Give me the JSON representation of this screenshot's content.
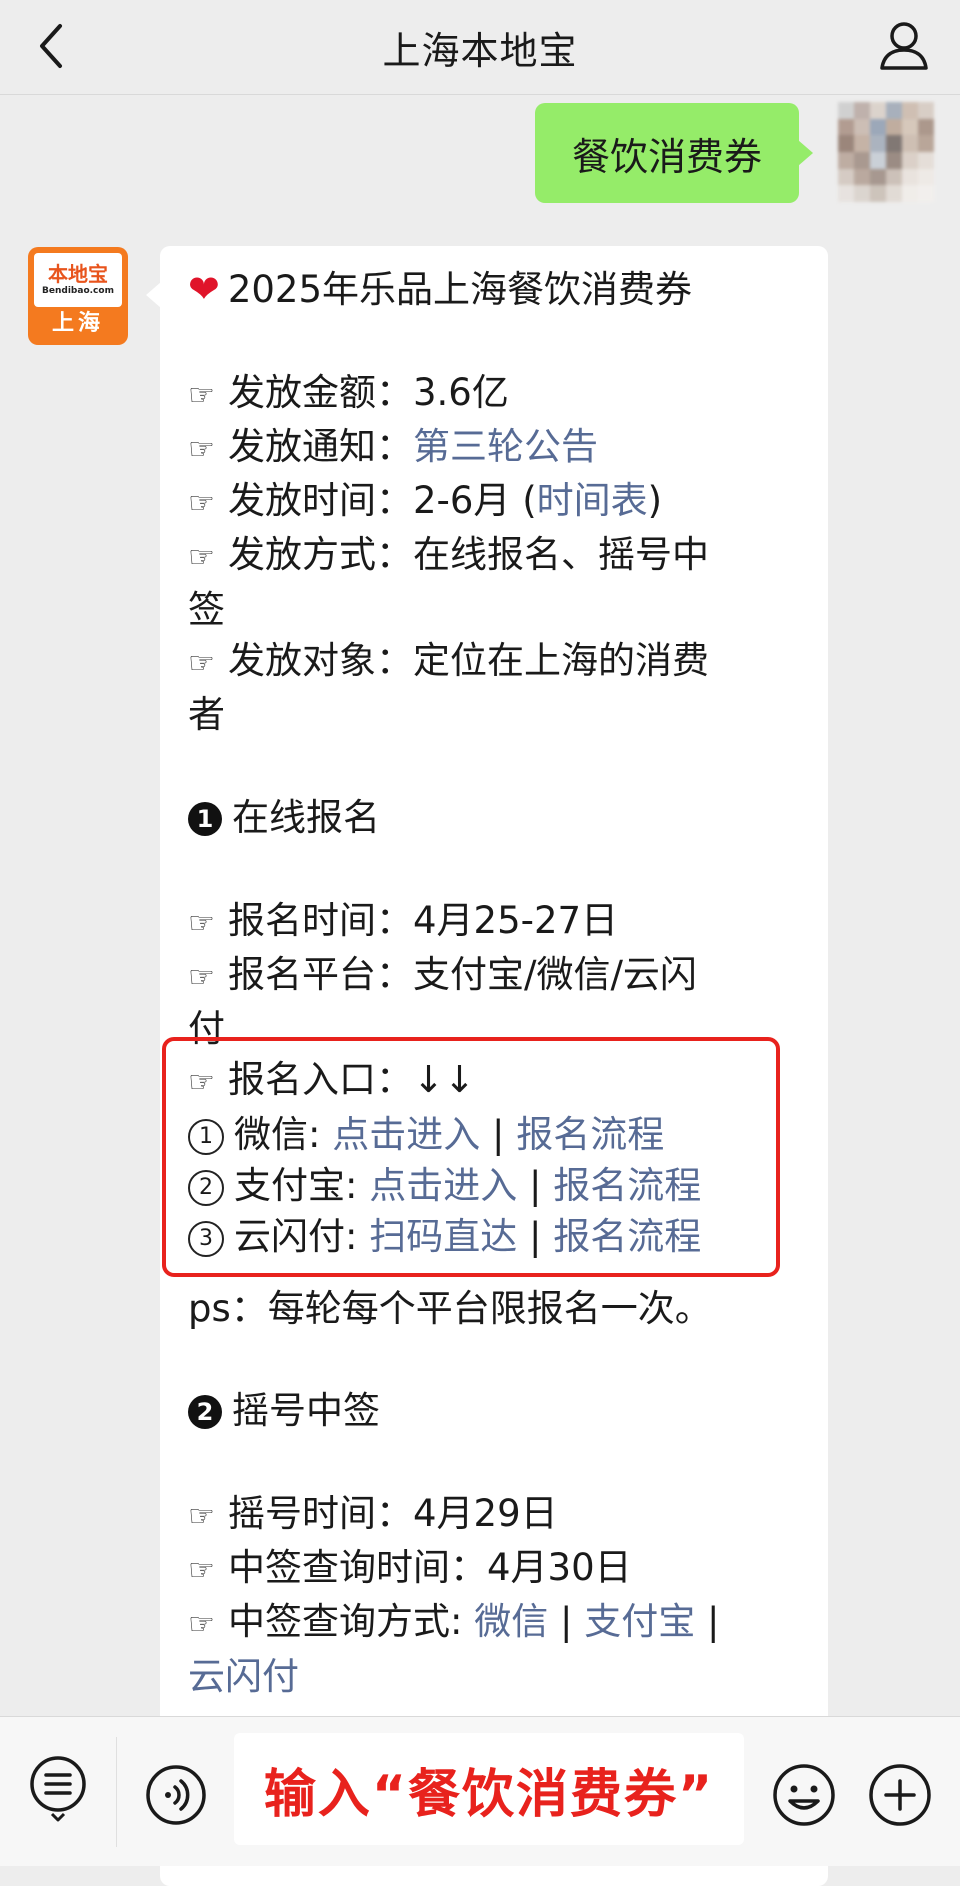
{
  "header": {
    "title": "上海本地宝"
  },
  "user_message": {
    "text": "餐饮消费券"
  },
  "bot": {
    "avatar_brand_cn": "本地宝",
    "avatar_brand_en": "Bendibao.com",
    "avatar_city": "上海"
  },
  "message": {
    "title": "2025年乐品上海餐饮消费券",
    "info": [
      {
        "label": "发放金额：",
        "value": "3.6亿"
      },
      {
        "label": "发放通知：",
        "link": "第三轮公告"
      },
      {
        "label": "发放时间：",
        "value": "2-6月 (",
        "link": "时间表",
        "suffix": ")"
      },
      {
        "label": "发放方式：",
        "value": "在线报名、摇号中",
        "wrap": "签"
      },
      {
        "label": "发放对象：",
        "value": "定位在上海的消费",
        "wrap": "者"
      }
    ],
    "section1": {
      "num": "1",
      "title": "在线报名",
      "time_label": "报名时间：",
      "time_value": "4月25-27日",
      "platform_label": "报名平台：",
      "platform_value": "支付宝/微信/云闪",
      "platform_wrap": "付",
      "entry_label": "报名入口：",
      "entry_arrows": "↓↓",
      "entries": [
        {
          "num": "1",
          "name": "微信: ",
          "link1": "点击进入",
          "sep": " | ",
          "link2": "报名流程"
        },
        {
          "num": "2",
          "name": "支付宝: ",
          "link1": "点击进入",
          "sep": " | ",
          "link2": "报名流程"
        },
        {
          "num": "3",
          "name": "云闪付: ",
          "link1": "扫码直达",
          "sep": " | ",
          "link2": "报名流程"
        }
      ],
      "ps": "ps：每轮每个平台限报名一次。"
    },
    "section2": {
      "num": "2",
      "title": "摇号中签",
      "lottery_label": "摇号时间：",
      "lottery_value": "4月29日",
      "query_time_label": "中签查询时间：",
      "query_time_value": "4月30日",
      "query_method_label": "中签查询方式: ",
      "query_link1": "微信",
      "query_sep1": " | ",
      "query_link2": "支付宝",
      "query_sep2": " |",
      "query_link3": "云闪付"
    }
  },
  "input": {
    "overlay_text": "输入“餐饮消费券”"
  },
  "colors": {
    "link": "#576b95",
    "user_bubble": "#95ec69",
    "highlight_red": "#e8221d",
    "brand_orange": "#f47a1f"
  }
}
